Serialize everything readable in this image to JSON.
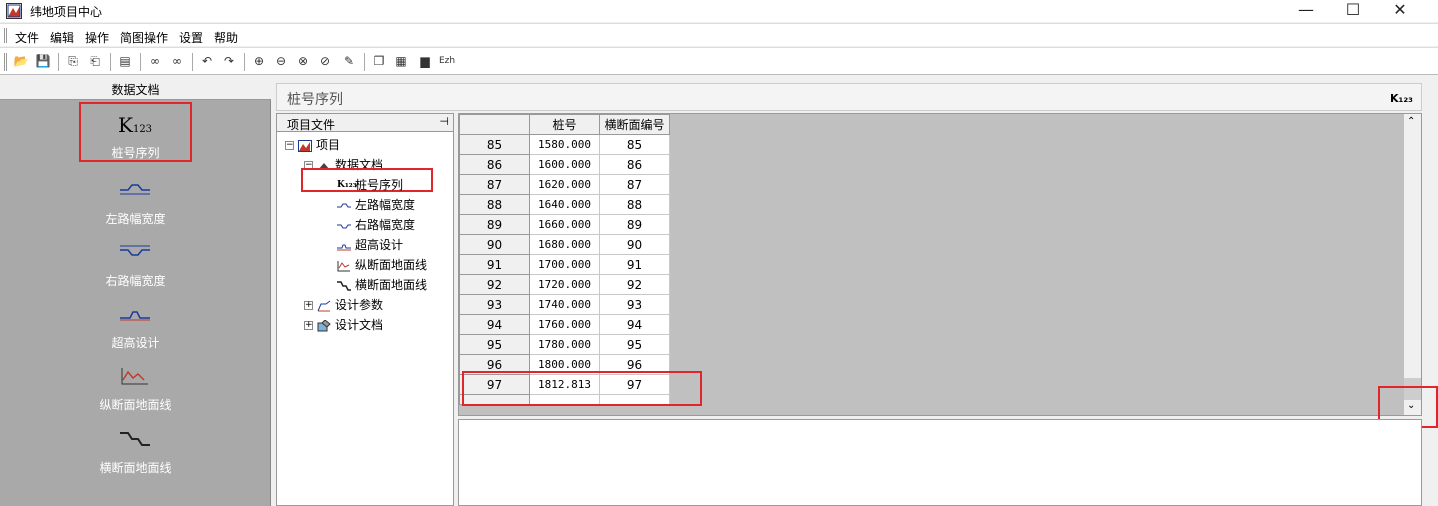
{
  "window": {
    "title": "纬地项目中心",
    "minimize": "—",
    "maximize": "☐",
    "close": "✕"
  },
  "menu": [
    "文件",
    "编辑",
    "操作",
    "简图操作",
    "设置",
    "帮助"
  ],
  "toolbar_icons": [
    "open-folder-icon",
    "save-icon",
    "copy-icon",
    "paste-icon",
    "print-preview-icon",
    "find-icon",
    "find-next-icon",
    "undo-icon",
    "redo-icon",
    "zoom-in-icon",
    "zoom-out-icon",
    "zoom-window-icon",
    "zoom-extent-icon",
    "pen-icon",
    "layers-icon",
    "grid-icon",
    "chart-icon",
    "text-icon"
  ],
  "left_panel": {
    "header": "数据文档",
    "items": [
      {
        "label": "桩号序列",
        "icon": "station-sequence-icon"
      },
      {
        "label": "左路幅宽度",
        "icon": "left-width-icon"
      },
      {
        "label": "右路幅宽度",
        "icon": "right-width-icon"
      },
      {
        "label": "超高设计",
        "icon": "superelevation-icon"
      },
      {
        "label": "纵断面地面线",
        "icon": "profile-ground-icon"
      },
      {
        "label": "横断面地面线",
        "icon": "cross-ground-icon"
      }
    ]
  },
  "right_header": {
    "title": "桩号序列",
    "icon_text": "K₁₂₃"
  },
  "tree": {
    "header": "项目文件",
    "pin": "⊣",
    "nodes": [
      {
        "label": "项目",
        "level": 0,
        "exp": "−",
        "icon": "project-icon"
      },
      {
        "label": "数据文档",
        "level": 1,
        "exp": "−",
        "icon": "data-doc-icon"
      },
      {
        "label": "桩号序列",
        "level": 2,
        "icon": "station-sequence-icon",
        "prefix": "K₁₂₃"
      },
      {
        "label": "左路幅宽度",
        "level": 2,
        "icon": "left-width-icon"
      },
      {
        "label": "右路幅宽度",
        "level": 2,
        "icon": "right-width-icon"
      },
      {
        "label": "超高设计",
        "level": 2,
        "icon": "superelevation-icon"
      },
      {
        "label": "纵断面地面线",
        "level": 2,
        "icon": "profile-ground-icon"
      },
      {
        "label": "横断面地面线",
        "level": 2,
        "icon": "cross-ground-icon"
      },
      {
        "label": "设计参数",
        "level": 1,
        "exp": "+",
        "icon": "design-params-icon"
      },
      {
        "label": "设计文档",
        "level": 1,
        "exp": "+",
        "icon": "design-doc-icon"
      }
    ]
  },
  "grid": {
    "headers": [
      "桩号",
      "横断面编号"
    ],
    "rows": [
      {
        "n": "85",
        "station": "1580.000",
        "section": "85"
      },
      {
        "n": "86",
        "station": "1600.000",
        "section": "86"
      },
      {
        "n": "87",
        "station": "1620.000",
        "section": "87"
      },
      {
        "n": "88",
        "station": "1640.000",
        "section": "88"
      },
      {
        "n": "89",
        "station": "1660.000",
        "section": "89"
      },
      {
        "n": "90",
        "station": "1680.000",
        "section": "90"
      },
      {
        "n": "91",
        "station": "1700.000",
        "section": "91"
      },
      {
        "n": "92",
        "station": "1720.000",
        "section": "92"
      },
      {
        "n": "93",
        "station": "1740.000",
        "section": "93"
      },
      {
        "n": "94",
        "station": "1760.000",
        "section": "94"
      },
      {
        "n": "95",
        "station": "1780.000",
        "section": "95"
      },
      {
        "n": "96",
        "station": "1800.000",
        "section": "96"
      },
      {
        "n": "97",
        "station": "1812.813",
        "section": "97"
      }
    ]
  },
  "colors": {
    "highlight": "#e0262c",
    "panel_gray": "#a9a9a9",
    "grid_bg": "#c0c0c0"
  }
}
